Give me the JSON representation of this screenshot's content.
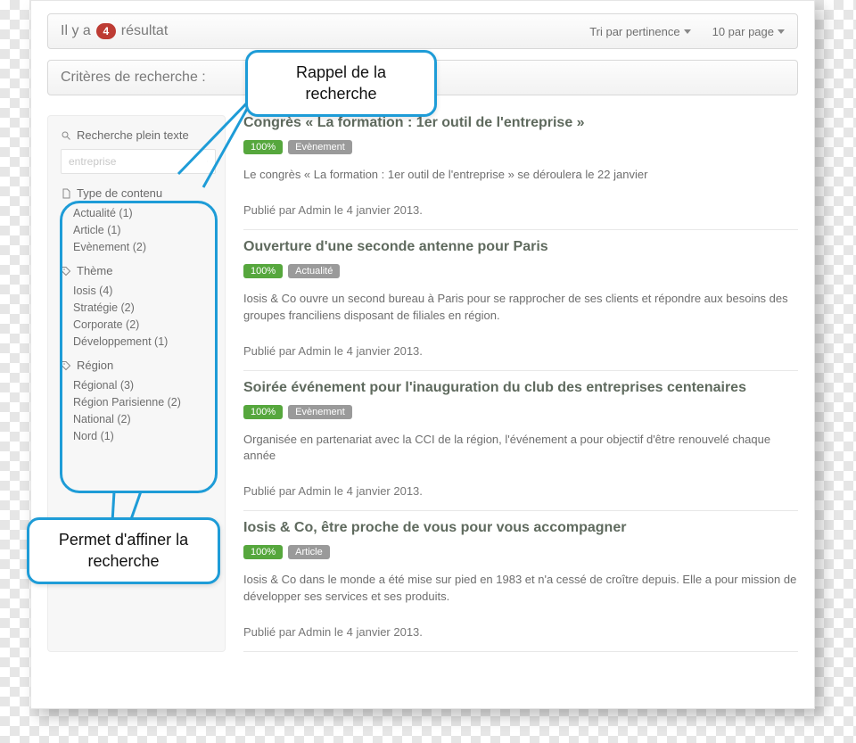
{
  "header": {
    "result_prefix": "Il y a",
    "result_count": "4",
    "result_suffix": "résultat",
    "sort_label": "Tri par pertinence",
    "perpage_label": "10 par page",
    "criteria_label": "Critères de recherche :"
  },
  "sidebar": {
    "search_title": "Recherche plein texte",
    "search_placeholder": "entreprise",
    "groups": [
      {
        "title": "Type de contenu",
        "icon": "file-icon",
        "items": [
          "Actualité (1)",
          "Article (1)",
          "Evènement (2)"
        ]
      },
      {
        "title": "Thème",
        "icon": "tag-icon",
        "items": [
          "Iosis (4)",
          "Stratégie (2)",
          "Corporate (2)",
          "Développement (1)"
        ]
      },
      {
        "title": "Région",
        "icon": "tag-icon",
        "items": [
          "Régional (3)",
          "Région Parisienne (2)",
          "National (2)",
          "Nord (1)"
        ]
      }
    ]
  },
  "results": [
    {
      "title": "Congrès « La formation : 1er outil de l'entreprise »",
      "score": "100%",
      "category": "Evènement",
      "excerpt": "Le congrès « La formation : 1er outil de l'entreprise » se déroulera le 22 janvier",
      "meta": "Publié par Admin le 4 janvier 2013."
    },
    {
      "title": "Ouverture d'une seconde antenne pour Paris",
      "score": "100%",
      "category": "Actualité",
      "excerpt": "Iosis & Co ouvre un second bureau à Paris pour se rapprocher de ses clients et répondre aux besoins des groupes franciliens disposant de filiales en région.",
      "meta": "Publié par Admin le 4 janvier 2013."
    },
    {
      "title": "Soirée événement pour l'inauguration du club des entreprises centenaires",
      "score": "100%",
      "category": "Evènement",
      "excerpt": "Organisée en partenariat avec la CCI de la région, l'événement a pour objectif d'être renouvelé chaque année",
      "meta": "Publié par Admin le 4 janvier 2013."
    },
    {
      "title": "Iosis & Co, être proche de vous pour vous accompagner",
      "score": "100%",
      "category": "Article",
      "excerpt": "Iosis & Co dans le monde a été mise sur pied en 1983 et n'a cessé de croître depuis. Elle a pour mission de développer ses services et ses produits.",
      "meta": "Publié par Admin le 4 janvier 2013."
    }
  ],
  "callouts": {
    "c1": "Rappel de la recherche",
    "c2": "Permet d'affiner la recherche"
  }
}
